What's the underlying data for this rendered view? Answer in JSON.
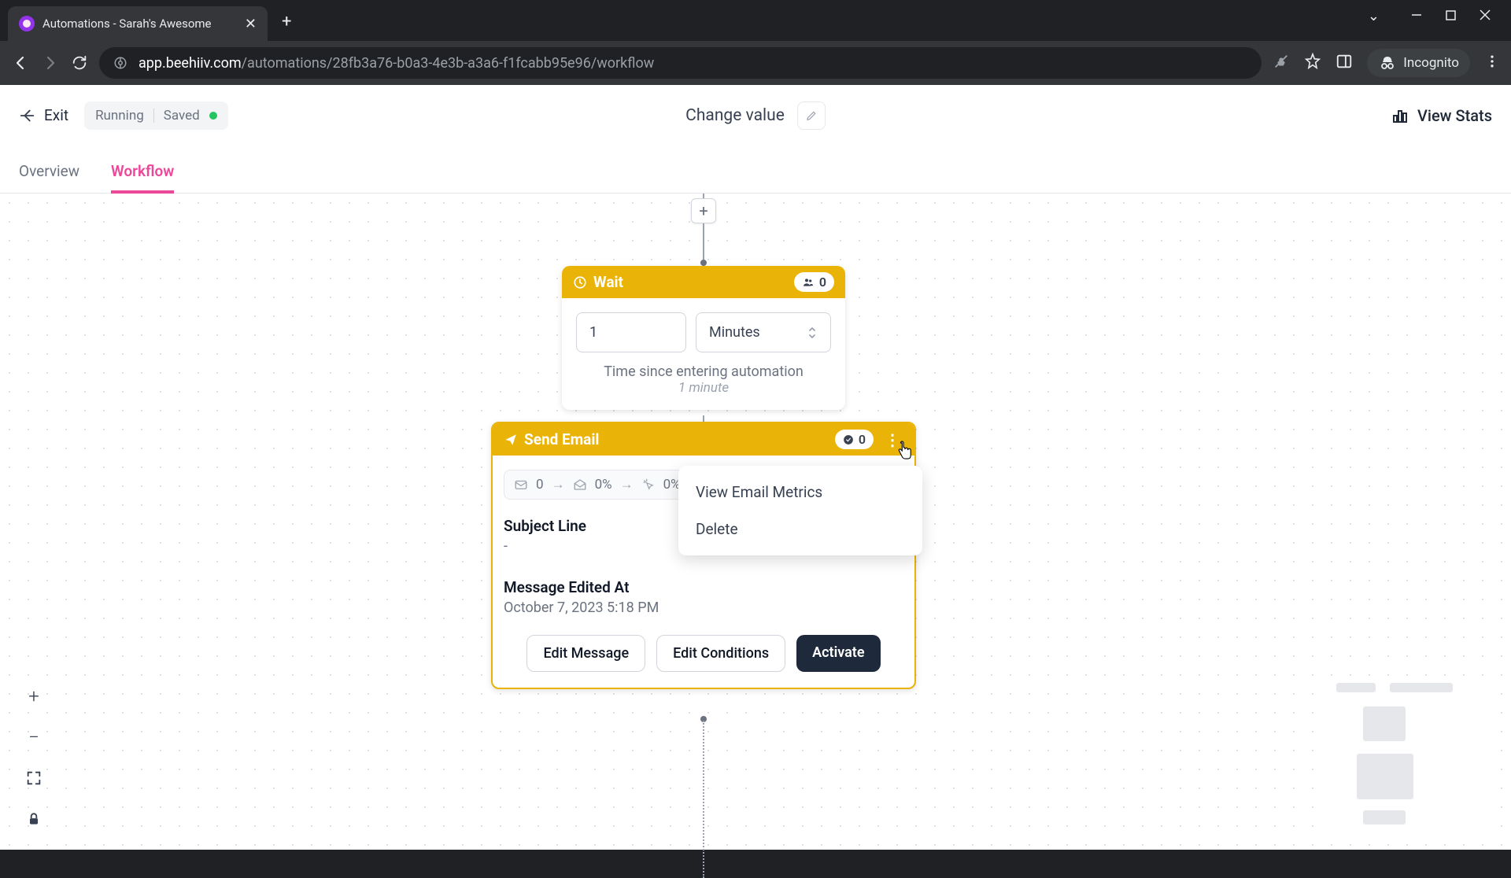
{
  "browser": {
    "tab_title": "Automations - Sarah's Awesome",
    "url_domain": "app.beehiiv.com",
    "url_path": "/automations/28fb3a76-b0a3-4e3b-a3a6-f1fcabb95e96/workflow",
    "incognito_label": "Incognito"
  },
  "header": {
    "exit_label": "Exit",
    "status_running": "Running",
    "status_saved": "Saved",
    "page_title": "Change value",
    "view_stats_label": "View Stats"
  },
  "tabs": {
    "overview": "Overview",
    "workflow": "Workflow"
  },
  "wait_node": {
    "title": "Wait",
    "badge_count": "0",
    "number_value": "1",
    "unit_value": "Minutes",
    "description": "Time since entering automation",
    "detail": "1 minute"
  },
  "email_node": {
    "title": "Send Email",
    "badge_count": "0",
    "metrics": {
      "sent": "0",
      "open_pct": "0%",
      "click_pct": "0%"
    },
    "subject_label": "Subject Line",
    "subject_value": "-",
    "edited_label": "Message Edited At",
    "edited_value": "October 7, 2023 5:18 PM",
    "edit_message_btn": "Edit Message",
    "edit_conditions_btn": "Edit Conditions",
    "activate_btn": "Activate"
  },
  "context_menu": {
    "view_metrics": "View Email Metrics",
    "delete": "Delete"
  }
}
